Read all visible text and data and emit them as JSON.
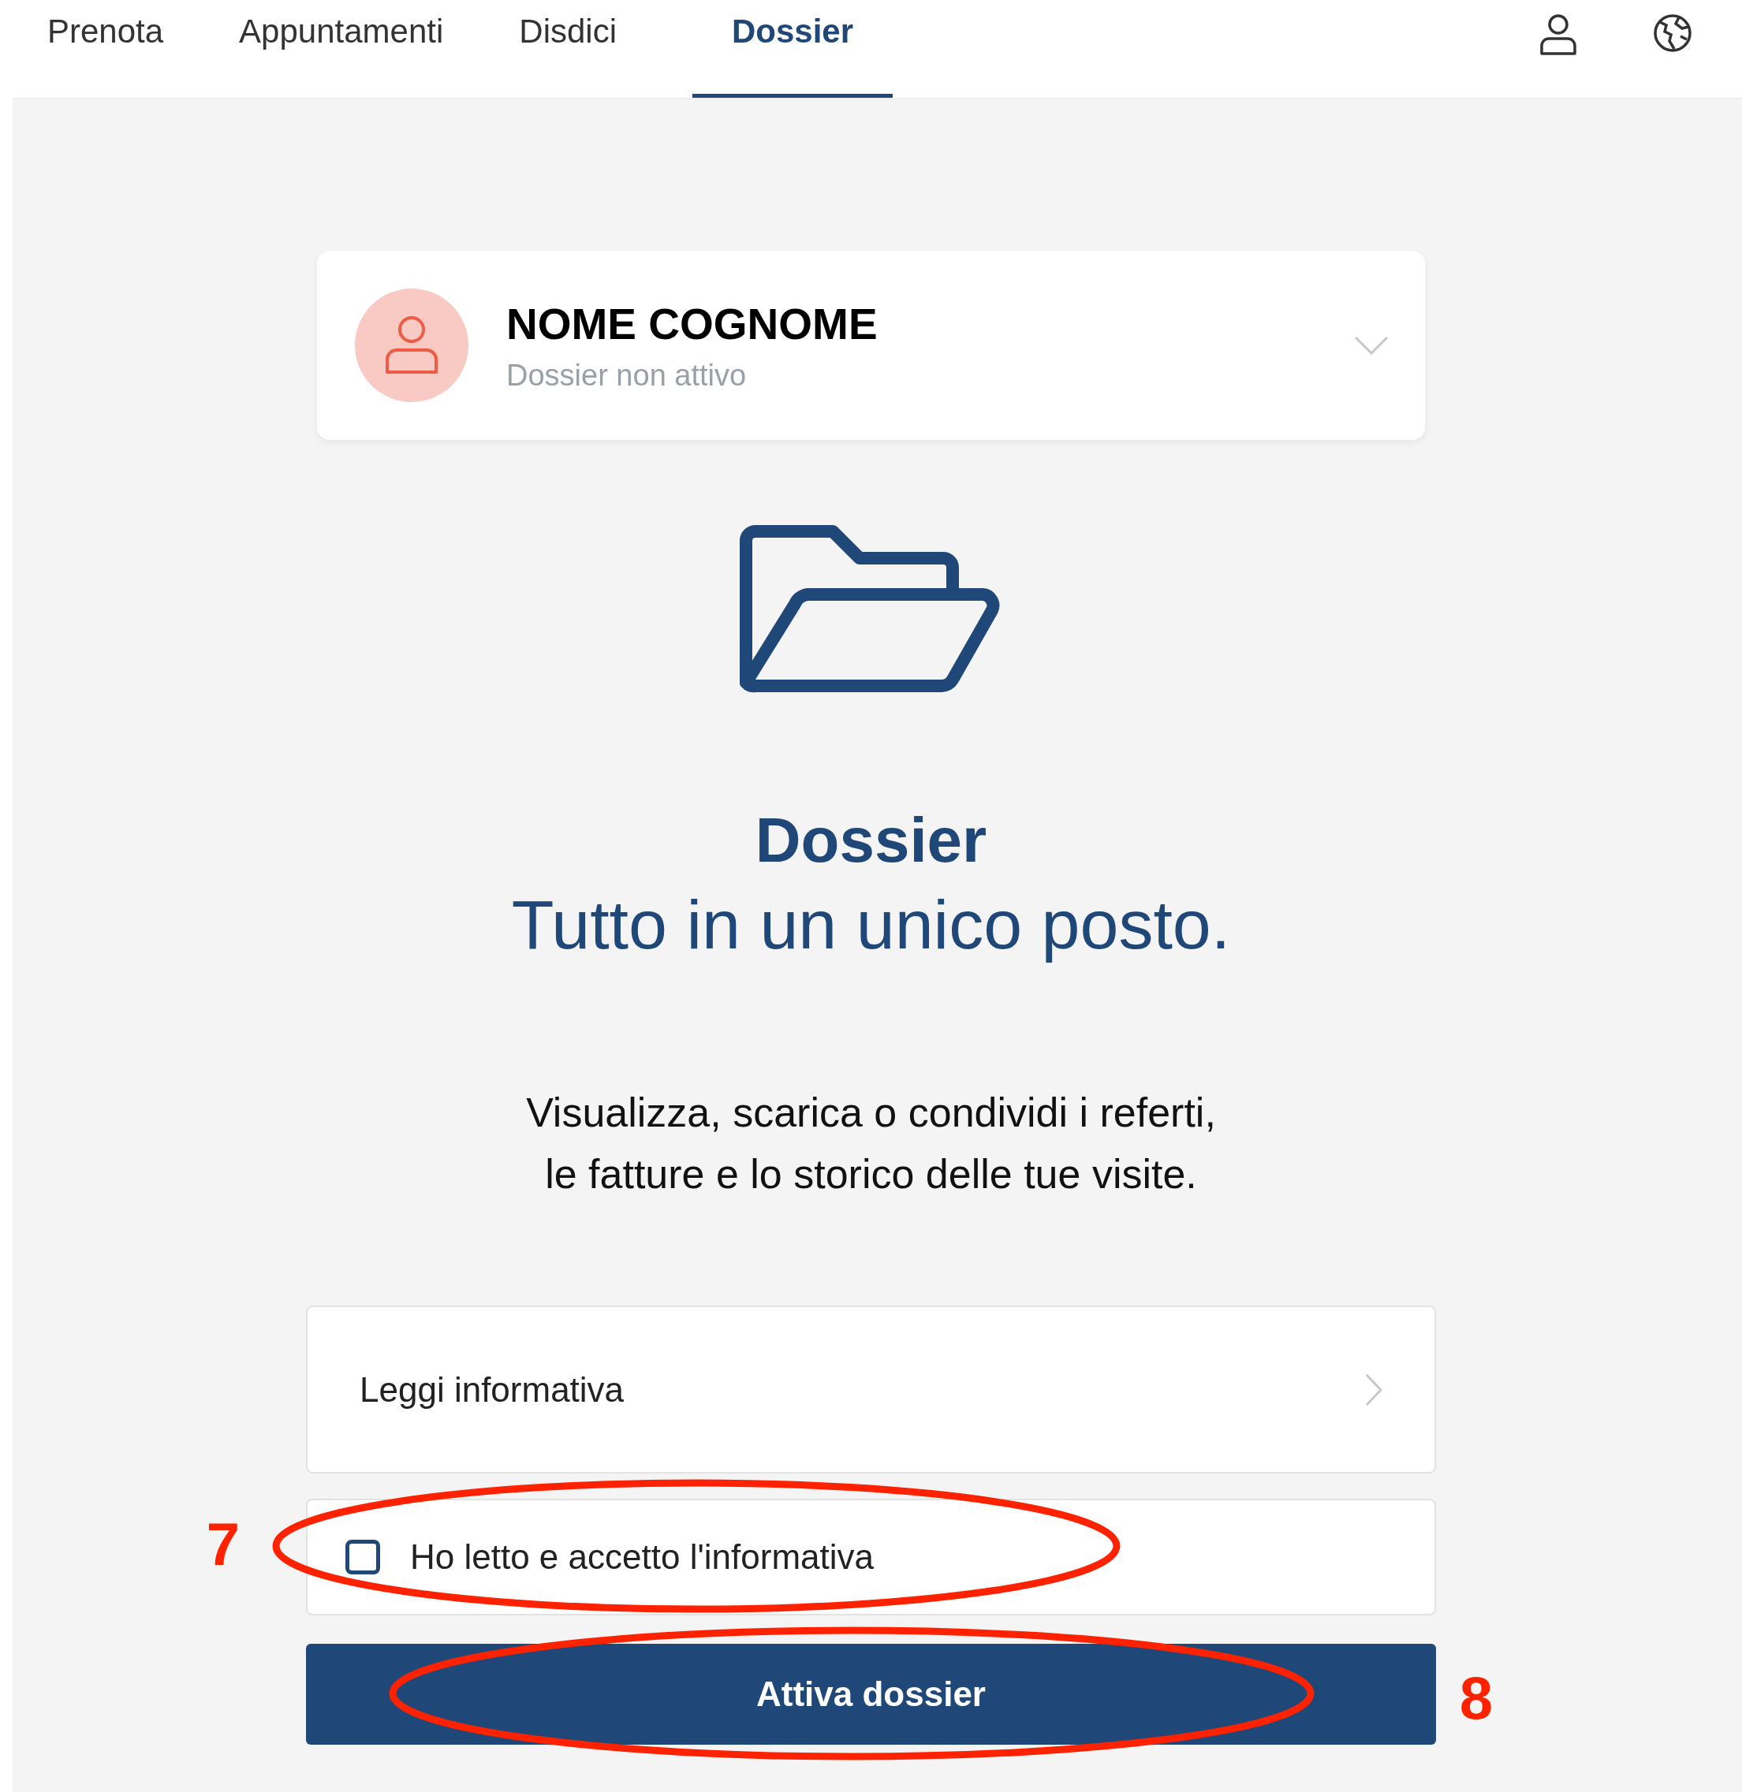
{
  "tabs": [
    {
      "label": "Prenota",
      "selected": false
    },
    {
      "label": "Appuntamenti",
      "selected": false
    },
    {
      "label": "Disdici",
      "selected": false
    },
    {
      "label": "Dossier",
      "selected": true
    }
  ],
  "profile": {
    "name": "NOME COGNOME",
    "status": "Dossier non attivo"
  },
  "hero": {
    "title": "Dossier",
    "subtitle": "Tutto in un unico posto.",
    "description": [
      "Visualizza, scarica o condividi i referti,",
      "le fatture e lo storico delle tue visite."
    ]
  },
  "info_link": {
    "label": "Leggi informativa"
  },
  "consent": {
    "label": "Ho letto e accetto l'informativa",
    "checked": false
  },
  "action_button": {
    "label": "Attiva dossier"
  },
  "annotations": [
    {
      "label": "7"
    },
    {
      "label": "8"
    }
  ]
}
